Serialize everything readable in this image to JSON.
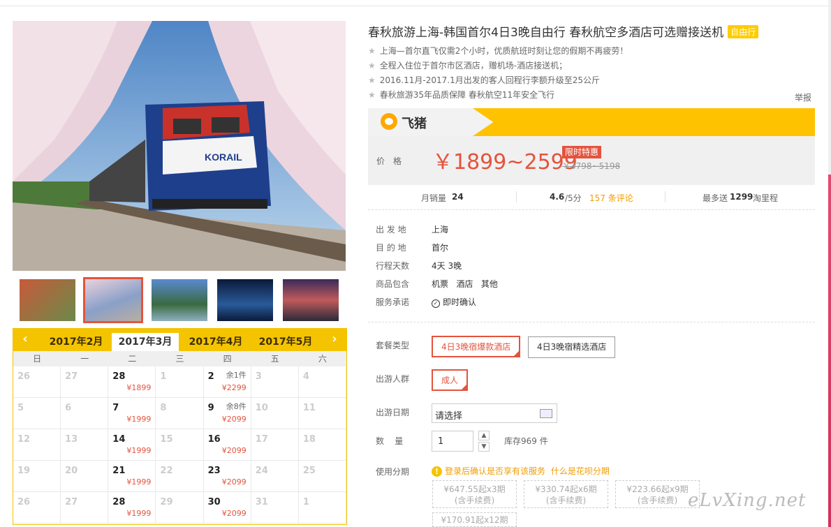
{
  "product": {
    "title": "春秋旅游上海-韩国首尔4日3晚自由行 春秋航空多酒店可选赠接送机",
    "tag": "自由行",
    "features": [
      "上海—首尔直飞仅需2个小时，优质航班时刻让您的假期不再疲劳！",
      "全程入住位于首尔市区酒店，赠机场-酒店接送机；",
      "2016.11月-2017.1月出发的客人回程行李额升级至25公斤",
      "春秋旅游35年品质保障 春秋航空11年安全飞行"
    ],
    "report": "举报"
  },
  "brand": {
    "name": "飞猪"
  },
  "price": {
    "label": "价格",
    "value": "￥1899~2599",
    "promo": "限时特惠",
    "original": "￥3798~5198"
  },
  "stats": {
    "monthly_sales_label": "月销量",
    "monthly_sales": "24",
    "rating": "4.6",
    "rating_suffix": "/5分",
    "reviews": "157 条评论",
    "mileage_prefix": "最多送",
    "mileage": "1299",
    "mileage_suffix": "淘里程"
  },
  "info": [
    {
      "label": "出 发 地",
      "value": "上海"
    },
    {
      "label": "目 的 地",
      "value": "首尔"
    },
    {
      "label": "行程天数",
      "value": "4天 3晚"
    },
    {
      "label": "商品包含",
      "value": "机票   酒店   其他"
    },
    {
      "label": "服务承诺",
      "value": "即时确认"
    }
  ],
  "options": {
    "package_label": "套餐类型",
    "packages": [
      "4日3晚宿爆款酒店",
      "4日3晚宿精选酒店"
    ],
    "crowd_label": "出游人群",
    "crowd": "成人",
    "date_label": "出游日期",
    "date_placeholder": "请选择",
    "qty_label": "数    量",
    "qty": "1",
    "stock": "库存969 件",
    "install_label": "使用分期",
    "install_notice": "登录后确认是否享有该服务",
    "install_link": "什么是花呗分期",
    "installments": [
      {
        "line1": "¥647.55起x3期",
        "line2": "(含手续费)"
      },
      {
        "line1": "¥330.74起x6期",
        "line2": "(含手续费)"
      },
      {
        "line1": "¥223.66起x9期",
        "line2": "(含手续费)"
      },
      {
        "line1": "¥170.91起x12期",
        "line2": ""
      }
    ]
  },
  "calendar": {
    "prev": "‹",
    "next": "›",
    "months": [
      "2017年2月",
      "2017年3月",
      "2017年4月",
      "2017年5月"
    ],
    "active_month": "2017年3月",
    "weekdays": [
      "日",
      "一",
      "二",
      "三",
      "四",
      "五",
      "六"
    ],
    "cells": [
      {
        "d": "26",
        "on": false
      },
      {
        "d": "27",
        "on": false
      },
      {
        "d": "28",
        "on": true,
        "p": "¥1899"
      },
      {
        "d": "1",
        "on": false
      },
      {
        "d": "2",
        "on": true,
        "s": "余1件",
        "p": "¥2299"
      },
      {
        "d": "3",
        "on": false
      },
      {
        "d": "4",
        "on": false
      },
      {
        "d": "5",
        "on": false
      },
      {
        "d": "6",
        "on": false
      },
      {
        "d": "7",
        "on": true,
        "p": "¥1999"
      },
      {
        "d": "8",
        "on": false
      },
      {
        "d": "9",
        "on": true,
        "s": "余8件",
        "p": "¥2099"
      },
      {
        "d": "10",
        "on": false
      },
      {
        "d": "11",
        "on": false
      },
      {
        "d": "12",
        "on": false
      },
      {
        "d": "13",
        "on": false
      },
      {
        "d": "14",
        "on": true,
        "p": "¥1999"
      },
      {
        "d": "15",
        "on": false
      },
      {
        "d": "16",
        "on": true,
        "p": "¥2099"
      },
      {
        "d": "17",
        "on": false
      },
      {
        "d": "18",
        "on": false
      },
      {
        "d": "19",
        "on": false
      },
      {
        "d": "20",
        "on": false
      },
      {
        "d": "21",
        "on": true,
        "p": "¥1999"
      },
      {
        "d": "22",
        "on": false
      },
      {
        "d": "23",
        "on": true,
        "p": "¥2099"
      },
      {
        "d": "24",
        "on": false
      },
      {
        "d": "25",
        "on": false
      },
      {
        "d": "26",
        "on": false
      },
      {
        "d": "27",
        "on": false
      },
      {
        "d": "28",
        "on": true,
        "p": "¥1999"
      },
      {
        "d": "29",
        "on": false
      },
      {
        "d": "30",
        "on": true,
        "p": "¥2099"
      },
      {
        "d": "31",
        "on": false
      },
      {
        "d": "1",
        "on": false
      }
    ]
  },
  "watermark": "eLvXing.net",
  "colors": {
    "accent": "#e4533d",
    "brand_yellow": "#ffc200"
  }
}
